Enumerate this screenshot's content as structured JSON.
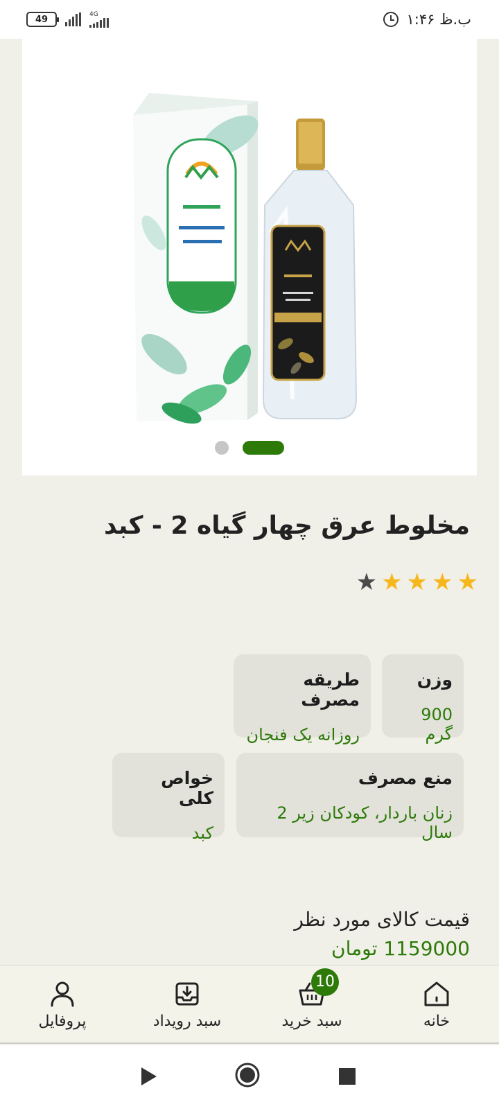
{
  "status_bar": {
    "time": "۱:۴۶ ب.ظ",
    "battery": "49",
    "network": "4G",
    "icons": [
      "alarm-icon",
      "signal-icon",
      "battery-icon"
    ]
  },
  "product": {
    "image_alt": "مخلوط عرق چهار گیاه 2 - کبد",
    "carousel": {
      "count": 2,
      "active_index": 1
    },
    "title": "مخلوط عرق چهار گیاه 2 - کبد",
    "rating": {
      "value": 4,
      "max": 5
    },
    "attributes": [
      {
        "label": "وزن",
        "value": "900 گرم"
      },
      {
        "label": "طریقه مصرف",
        "value": "روزانه یک فنجان"
      },
      {
        "label": "منع مصرف",
        "value": "زنان باردار، کودکان زیر 2 سال"
      },
      {
        "label": "خواص کلی",
        "value": "کبد"
      }
    ],
    "price": {
      "label": "قیمت کالای مورد نظر",
      "value": "1159000 تومان"
    }
  },
  "bottom_nav": {
    "items": [
      {
        "label": "خانه",
        "icon": "home-icon"
      },
      {
        "label": "سبد خرید",
        "icon": "basket-icon",
        "badge": "10"
      },
      {
        "label": "سبد رویداد",
        "icon": "inbox-icon"
      },
      {
        "label": "پروفایل",
        "icon": "user-icon"
      }
    ]
  },
  "system_nav": {
    "icons": [
      "back-icon",
      "home-circle-icon",
      "recents-icon"
    ]
  },
  "colors": {
    "accent": "#2d7a09",
    "star": "#f5b71c",
    "background": "#f0efe8",
    "card": "#e2e2da"
  }
}
